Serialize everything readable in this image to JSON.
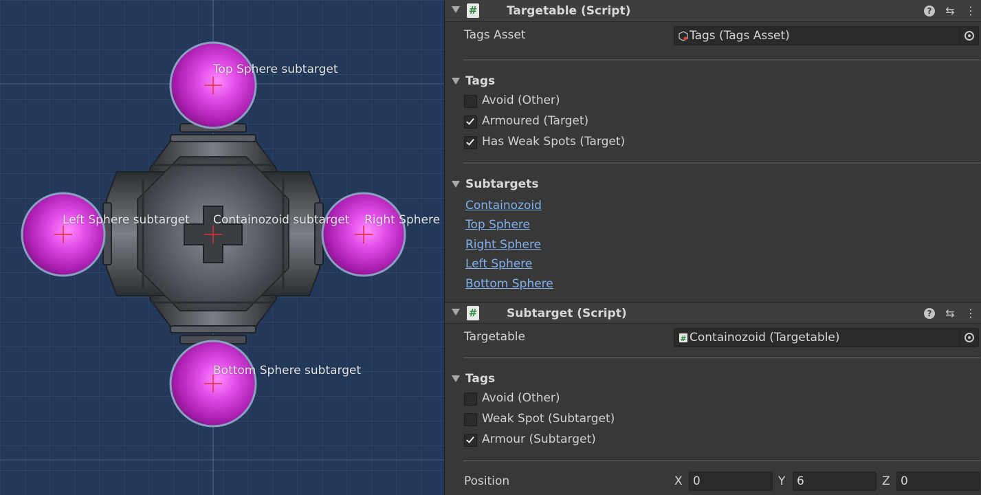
{
  "scene": {
    "labels": {
      "top": "Top Sphere subtarget",
      "left": "Left Sphere subtarget",
      "center": "Containozoid subtarget",
      "right": "Right Sphere",
      "bottom": "Bottom Sphere subtarget"
    },
    "colors": {
      "background": "#23395a",
      "sphere": "#d23ed8",
      "body": "#55595e"
    }
  },
  "targetable": {
    "title": "Targetable (Script)",
    "script_icon": "#",
    "tags_asset_label": "Tags Asset",
    "tags_asset_value": "Tags (Tags Asset)",
    "tags_section": "Tags",
    "tags": [
      {
        "label": "Avoid (Other)",
        "checked": false
      },
      {
        "label": "Armoured (Target)",
        "checked": true
      },
      {
        "label": "Has Weak Spots (Target)",
        "checked": true
      }
    ],
    "subtargets_section": "Subtargets",
    "subtargets": [
      "Containozoid",
      "Top Sphere",
      "Right Sphere",
      "Left Sphere",
      "Bottom Sphere"
    ]
  },
  "subtarget": {
    "title": "Subtarget (Script)",
    "script_icon": "#",
    "targetable_label": "Targetable",
    "targetable_value": "Containozoid (Targetable)",
    "tags_section": "Tags",
    "tags": [
      {
        "label": "Avoid (Other)",
        "checked": false
      },
      {
        "label": "Weak Spot (Subtarget)",
        "checked": false
      },
      {
        "label": "Armour (Subtarget)",
        "checked": true
      }
    ],
    "position_label": "Position",
    "position": {
      "x_label": "X",
      "x": "0",
      "y_label": "Y",
      "y": "6",
      "z_label": "Z",
      "z": "0"
    }
  },
  "header_buttons": {
    "help": "?",
    "presets": "⇆",
    "menu": "⋮"
  },
  "accent": {
    "link": "#7fb0ec",
    "script_icon": "#2f8a3f"
  }
}
